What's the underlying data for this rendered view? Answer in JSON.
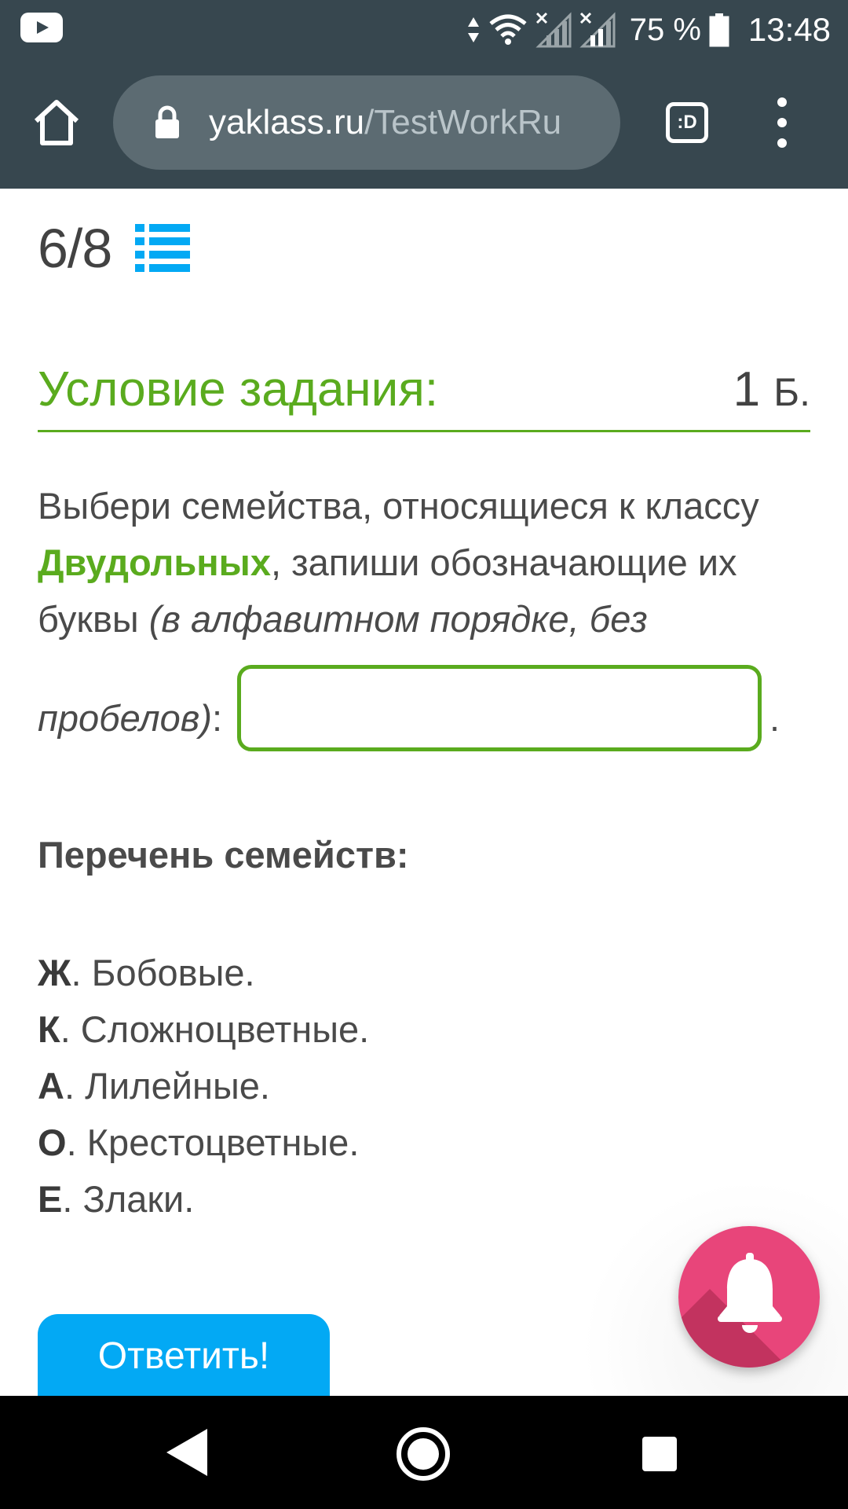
{
  "status_bar": {
    "battery": "75 %",
    "time": "13:48"
  },
  "browser": {
    "url_host": "yaklass.ru",
    "url_path": "/TestWorkRu",
    "tabs_label": ":D"
  },
  "progress": {
    "label": "6/8"
  },
  "task": {
    "title": "Условие задания:",
    "points_value": "1",
    "points_unit": "Б."
  },
  "question": {
    "text_1": "Выбери семейства, относящиеся к классу ",
    "highlight": "Двудольных",
    "text_2": ", запиши обозначающие их буквы ",
    "hint_part_1": "(в алфавитном порядке, без",
    "hint_part_2": "пробелов)",
    "colon": ":",
    "answer_value": "",
    "trailing": "."
  },
  "families": {
    "title": "Перечень семейств:",
    "items": [
      {
        "letter": "Ж",
        "rest": ". Бобовые."
      },
      {
        "letter": "К",
        "rest": ". Сложноцветные."
      },
      {
        "letter": "А",
        "rest": ". Лилейные."
      },
      {
        "letter": "О",
        "rest": ". Крестоцветные."
      },
      {
        "letter": "Е",
        "rest": ". Злаки."
      }
    ]
  },
  "actions": {
    "answer_button": "Ответить!"
  },
  "colors": {
    "accent_green": "#5aab1e",
    "button_blue": "#03a9f4",
    "bell_pink": "#e8457a",
    "chrome_dark": "#37474f"
  },
  "icons": {
    "app_notification": "youtube-icon",
    "signal": "wifi-icon",
    "home": "home-icon",
    "lock": "lock-icon",
    "tabs": "tabs-icon",
    "menu": "more-vert-icon",
    "list": "list-icon",
    "bell": "bell-icon",
    "nav_back": "back-icon",
    "nav_home": "nav-home-icon",
    "nav_recents": "recents-icon"
  }
}
